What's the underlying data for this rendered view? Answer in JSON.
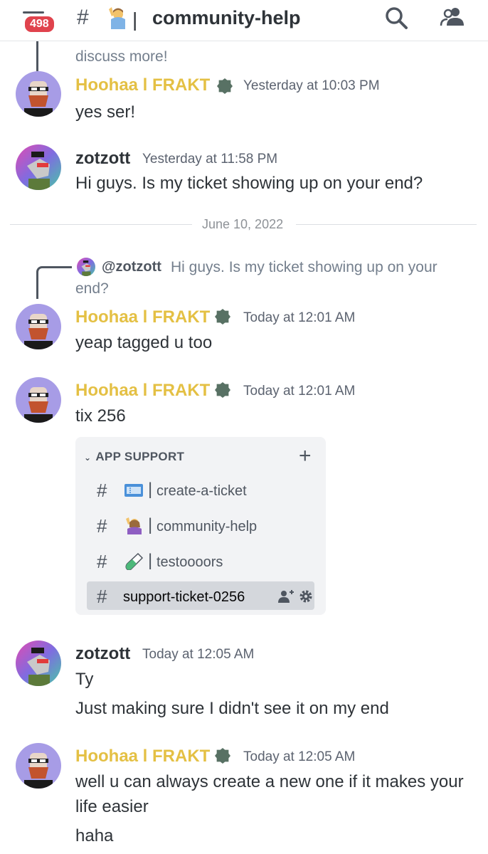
{
  "header": {
    "badge_count": "498",
    "hash": "#",
    "separator": "|",
    "channel_name": "community-help",
    "icons": [
      "menu-icon",
      "person-raising-hand-emoji",
      "search-icon",
      "members-icon"
    ]
  },
  "messages": {
    "prev_fragment": "discuss more!",
    "m1": {
      "author": "Hoohaa l FRAKT",
      "time": "Yesterday at 10:03 PM",
      "text": "yes ser!"
    },
    "m2": {
      "author": "zotzott",
      "time": "Yesterday at 11:58 PM",
      "text": "Hi guys. Is my ticket showing up on your end?"
    },
    "date_divider": "June 10, 2022",
    "reply": {
      "mention": "@zotzott",
      "text_line1": "Hi guys. Is my ticket showing up on your",
      "text_line2": "end?"
    },
    "m3": {
      "author": "Hoohaa l FRAKT",
      "time": "Today at 12:01 AM",
      "text": "yeap tagged u too"
    },
    "m4": {
      "author": "Hoohaa l FRAKT",
      "time": "Today at 12:01 AM",
      "text": "tix 256"
    },
    "m5": {
      "author": "zotzott",
      "time": "Today at 12:05 AM",
      "line1": "Ty",
      "line2": "Just making sure I didn't see it on my end"
    },
    "m6": {
      "author": "Hoohaa l FRAKT",
      "time": "Today at 12:05 AM",
      "line1": "well u can always create a new one if it makes your",
      "line2": "life easier",
      "line3": "haha"
    }
  },
  "embed": {
    "category": "APP SUPPORT",
    "plus": "+",
    "channels": [
      {
        "hash": "#",
        "sep": "|",
        "name": "create-a-ticket",
        "icon": "ticket-emoji"
      },
      {
        "hash": "#",
        "sep": "|",
        "name": "community-help",
        "icon": "person-raising-hand-emoji"
      },
      {
        "hash": "#",
        "sep": "|",
        "name": "testoooors",
        "icon": "test-tube-emoji"
      },
      {
        "hash": "#",
        "name": "support-ticket-0256",
        "icon": "private-thread-hash-icon"
      }
    ]
  },
  "colors": {
    "hoohaa_name": "#e4c044",
    "badge": "#e0434d",
    "bot_badge": "#587164"
  }
}
